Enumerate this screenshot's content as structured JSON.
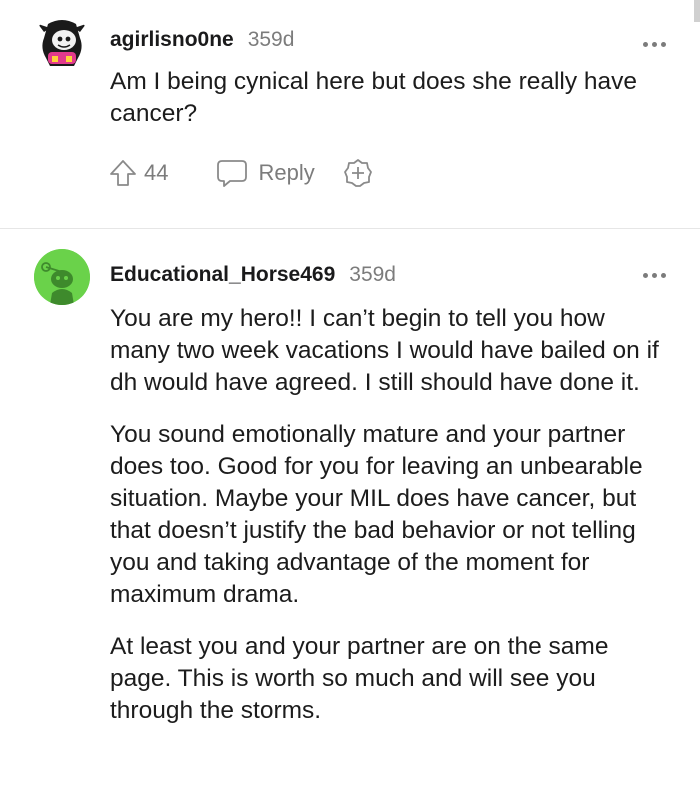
{
  "comments": [
    {
      "username": "agirlisno0ne",
      "age": "359d",
      "paragraphs": [
        "Am I being cynical here but does she really have cancer?"
      ],
      "votes": "44",
      "reply_label": "Reply",
      "avatar_icon": "snoo-avatar-dark",
      "icons": [
        "upvote-arrow-icon",
        "speech-bubble-icon",
        "award-plus-icon",
        "more-options-icon"
      ]
    },
    {
      "username": "Educational_Horse469",
      "age": "359d",
      "paragraphs": [
        "You are my hero!! I can’t begin to tell you how many two week vacations I would have bailed on if dh would have agreed. I still should have done it.",
        "You sound emotionally mature and your partner does too. Good for you for leaving an unbearable situation. Maybe your MIL does have cancer, but that doesn’t justify the bad behavior or not telling you and taking advantage of the moment for maximum drama.",
        "At least you and your partner are on the same page. This is worth so much and will see you through the storms."
      ],
      "avatar_icon": "snoo-avatar-green",
      "accent_color": "#6ad24a"
    }
  ]
}
